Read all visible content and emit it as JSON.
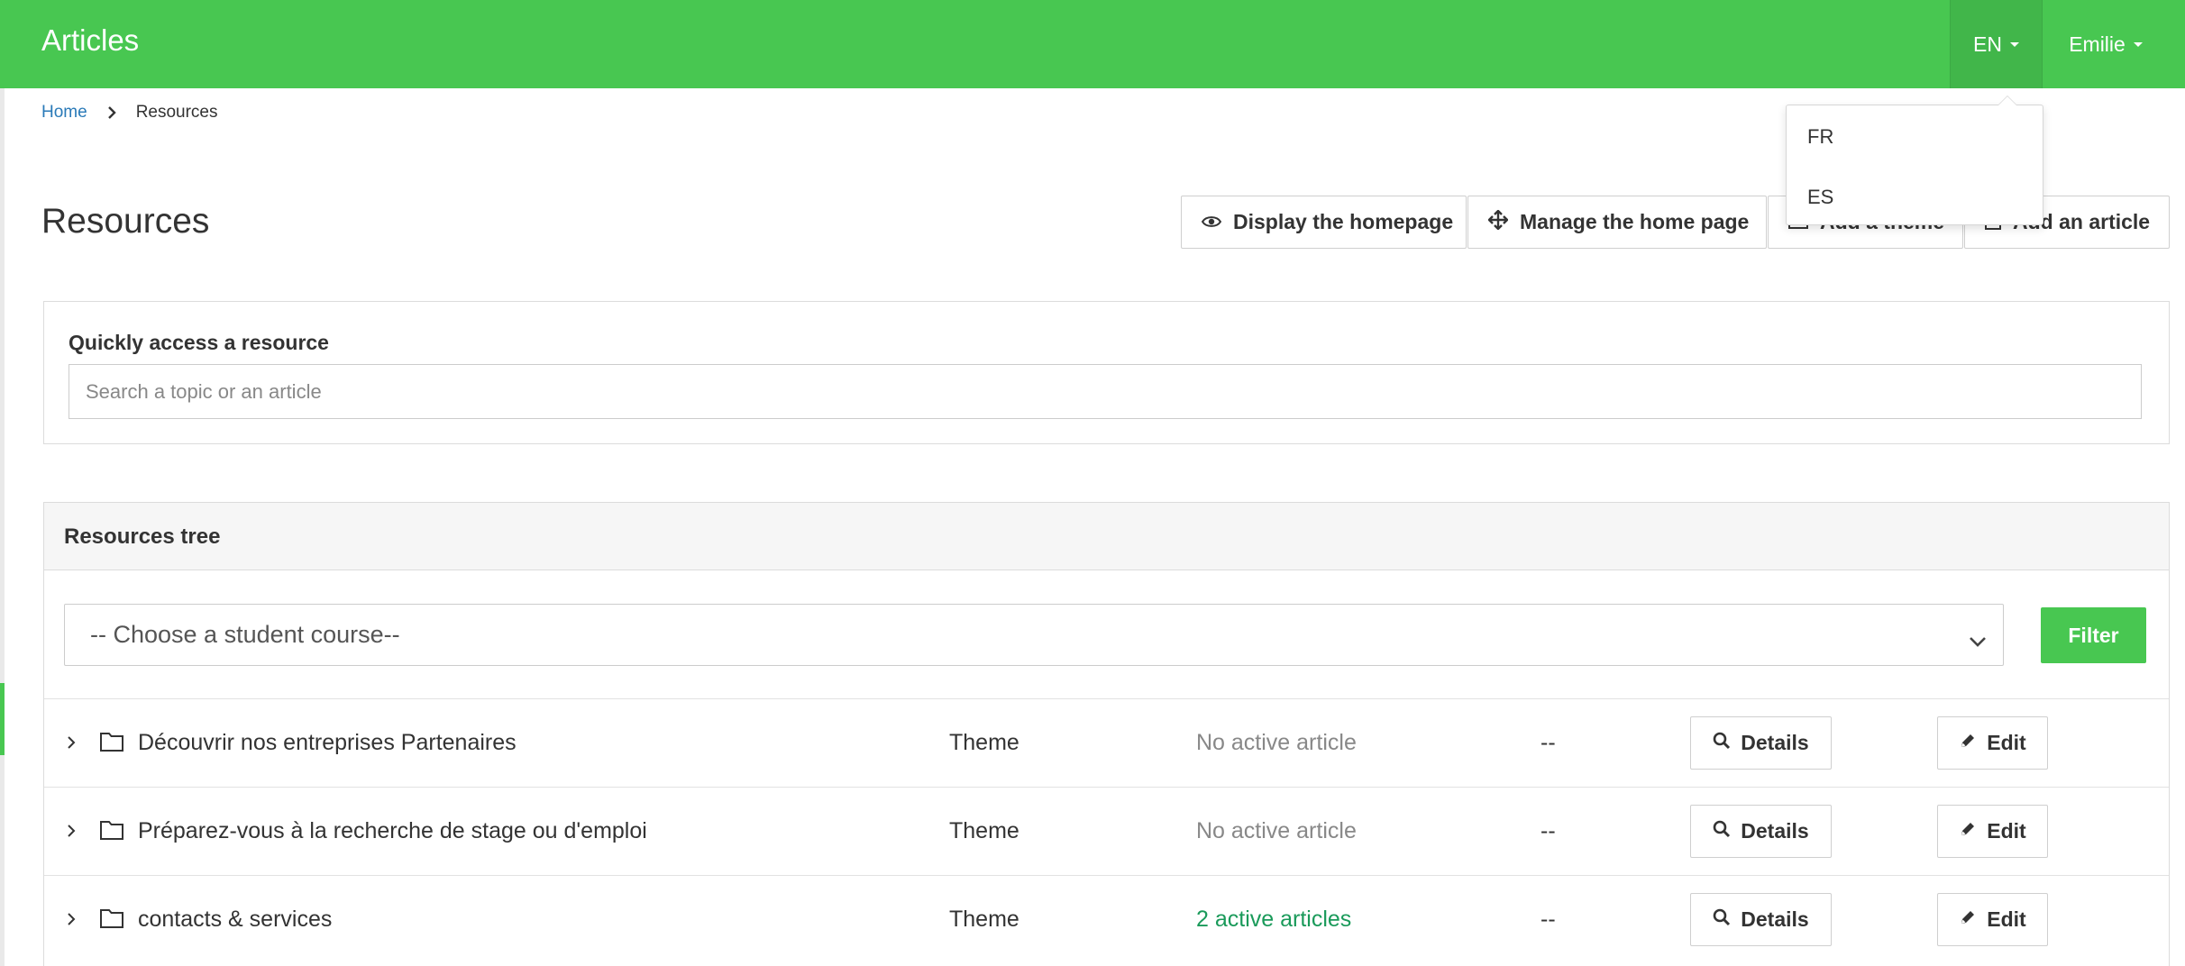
{
  "header": {
    "title": "Articles",
    "language_current": "EN",
    "user_name": "Emilie"
  },
  "language_menu": {
    "items": [
      "FR",
      "ES"
    ]
  },
  "breadcrumb": {
    "home": "Home",
    "current": "Resources"
  },
  "page": {
    "title": "Resources"
  },
  "actions": {
    "display_homepage": "Display the homepage",
    "manage_homepage": "Manage the home page",
    "add_theme": "Add a theme",
    "add_article": "Add an article"
  },
  "quick_access": {
    "label": "Quickly access a resource",
    "placeholder": "Search a topic or an article"
  },
  "tree": {
    "title": "Resources tree",
    "course_select_value": "-- Choose a student course--",
    "filter_label": "Filter",
    "rows": [
      {
        "name": "Découvrir nos entreprises Partenaires",
        "type": "Theme",
        "status": "No active article",
        "status_kind": "inactive",
        "extra": "--",
        "details_label": "Details",
        "edit_label": "Edit"
      },
      {
        "name": "Préparez-vous à la recherche de stage ou d'emploi",
        "type": "Theme",
        "status": "No active article",
        "status_kind": "inactive",
        "extra": "--",
        "details_label": "Details",
        "edit_label": "Edit"
      },
      {
        "name": "contacts & services",
        "type": "Theme",
        "status": "2 active articles",
        "status_kind": "active",
        "extra": "--",
        "details_label": "Details",
        "edit_label": "Edit"
      }
    ]
  },
  "colors": {
    "brand_green": "#48c751",
    "active_green": "#1a9a5a",
    "link_blue": "#2a7ab8"
  },
  "icons": {
    "display_homepage": "eye-icon",
    "manage_homepage": "move-arrows-icon",
    "add_theme": "folder-icon",
    "add_article": "document-icon",
    "row_expand": "chevron-right-icon",
    "row_folder": "folder-icon",
    "details": "search-icon",
    "edit": "pencil-icon"
  }
}
